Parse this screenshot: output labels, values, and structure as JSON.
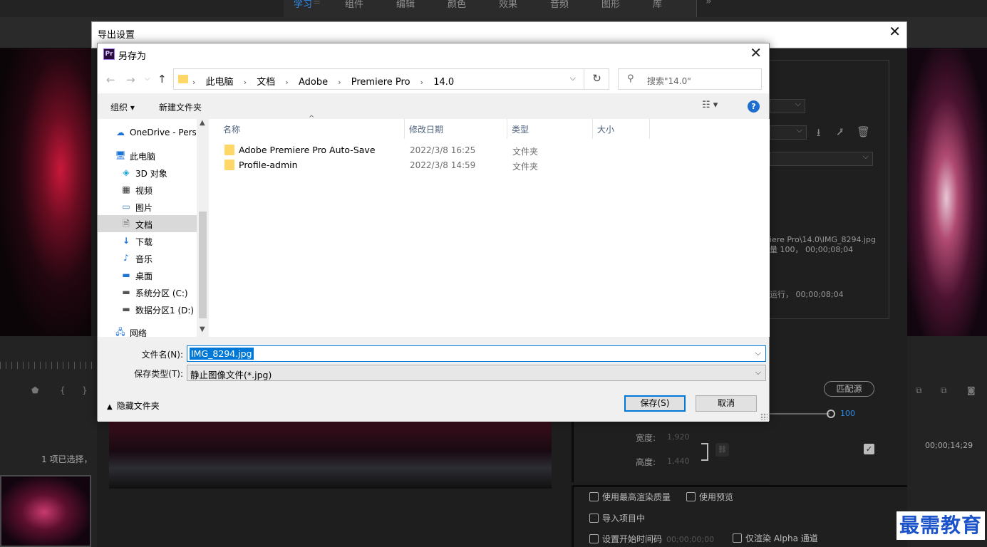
{
  "premiere": {
    "workspace_tabs": [
      "学习",
      "组件",
      "编辑",
      "颜色",
      "效果",
      "音频",
      "图形",
      "库"
    ],
    "active_tab_index": 0,
    "more_icon": "double-chevron-right-icon",
    "selected_count_text": "1 项已选择，",
    "output_path_line1": "iere Pro\\14.0\\IMG_8294.jpg",
    "output_path_line2": "量 100， 00;00;08;04",
    "output_path_line3": "运行， 00;00;08;04",
    "match_source_label": "匹配源",
    "quality_value": "100",
    "width_label": "宽度:",
    "width_value": "1,920",
    "height_label": "高度:",
    "height_value": "1,440",
    "timecode": "00;00;14;29",
    "checkbox_max_quality": "使用最高渲染质量",
    "checkbox_use_preview": "使用预览",
    "checkbox_import": "导入项目中",
    "checkbox_start_tc": "设置开始时间码",
    "start_tc_value": "00;00;00;00",
    "checkbox_alpha": "仅渲染 Alpha 通道",
    "accent_color": "#2d8ceb"
  },
  "watermark": "最需教育",
  "export_window": {
    "title": "导出设置",
    "close_icon": "close-icon"
  },
  "dialog": {
    "app_icon_text": "Pr",
    "title": "另存为",
    "breadcrumbs": [
      "此电脑",
      "文档",
      "Adobe",
      "Premiere Pro",
      "14.0"
    ],
    "search_placeholder": "搜索\"14.0\"",
    "toolbar": {
      "organize": "组织 ▾",
      "new_folder": "新建文件夹",
      "view_icon": "view-options-icon",
      "help": "?"
    },
    "nav_items": [
      {
        "label": "OneDrive - Perso",
        "icon": "onedrive-icon"
      },
      {
        "label": "此电脑",
        "icon": "computer-icon"
      },
      {
        "label": "3D 对象",
        "icon": "3d-objects-icon"
      },
      {
        "label": "视频",
        "icon": "video-icon"
      },
      {
        "label": "图片",
        "icon": "pictures-icon"
      },
      {
        "label": "文档",
        "icon": "documents-icon"
      },
      {
        "label": "下载",
        "icon": "downloads-icon"
      },
      {
        "label": "音乐",
        "icon": "music-icon"
      },
      {
        "label": "桌面",
        "icon": "desktop-icon"
      },
      {
        "label": "系统分区 (C:)",
        "icon": "drive-icon"
      },
      {
        "label": "数据分区1 (D:)",
        "icon": "drive-icon"
      },
      {
        "label": "网络",
        "icon": "network-icon"
      }
    ],
    "selected_nav_index": 5,
    "columns": [
      "名称",
      "修改日期",
      "类型",
      "大小"
    ],
    "files": [
      {
        "name": "Adobe Premiere Pro Auto-Save",
        "date": "2022/3/8 16:25",
        "type": "文件夹",
        "size": ""
      },
      {
        "name": "Profile-admin",
        "date": "2022/3/8 14:59",
        "type": "文件夹",
        "size": ""
      }
    ],
    "filename_label": "文件名(N):",
    "filename_value": "IMG_8294.jpg",
    "filetype_label": "保存类型(T):",
    "filetype_value": "静止图像文件(*.jpg)",
    "hide_folders": "隐藏文件夹",
    "save_button": "保存(S)",
    "cancel_button": "取消"
  }
}
